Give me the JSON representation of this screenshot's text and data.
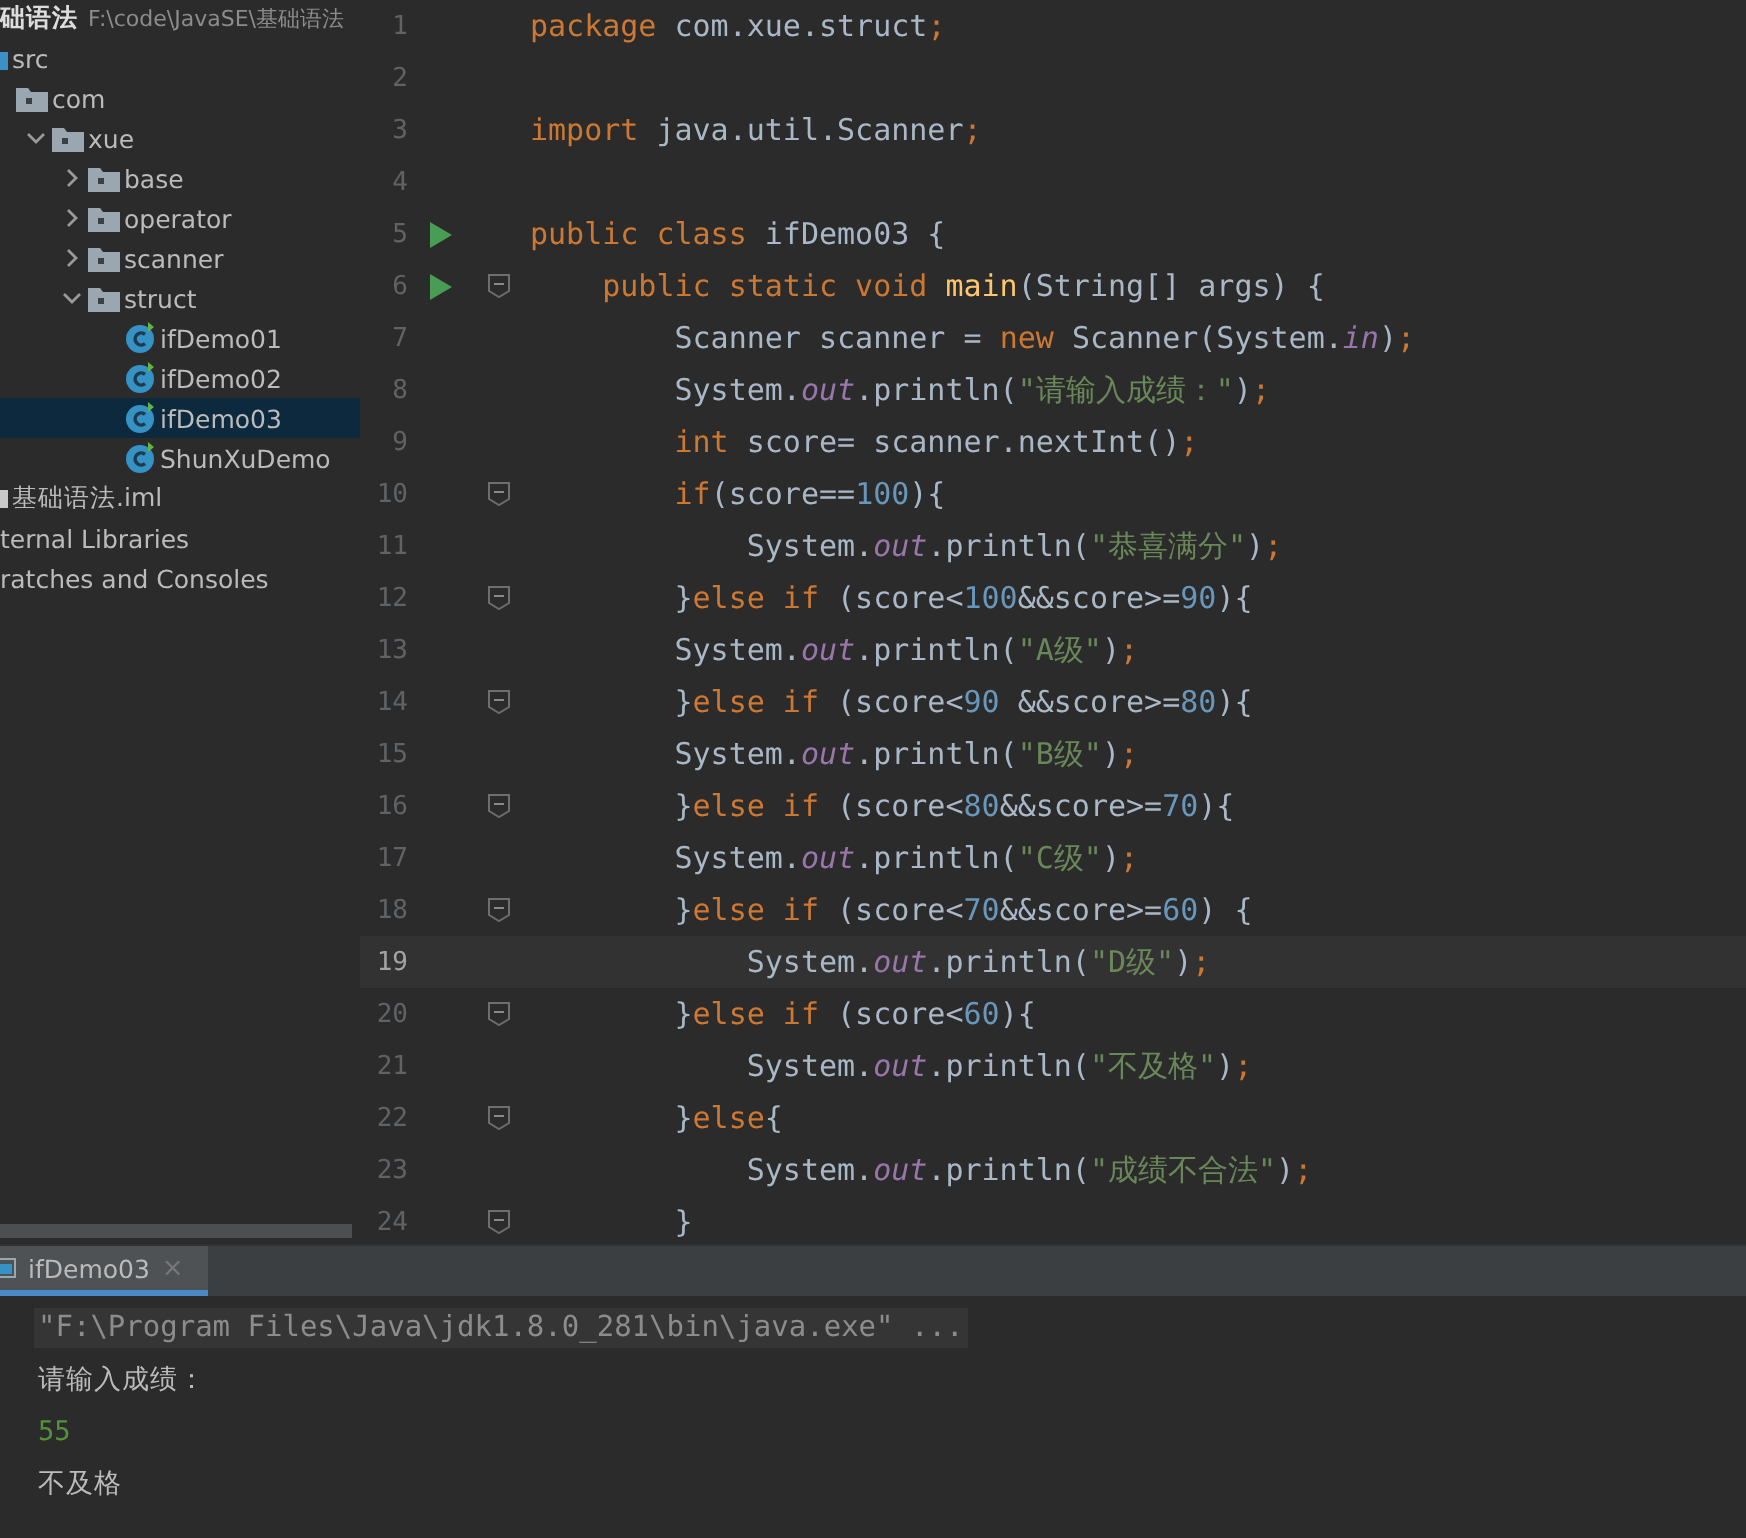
{
  "project_header": {
    "name": "础语法",
    "path": "F:\\code\\JavaSE\\基础语法"
  },
  "project_tree": [
    {
      "label": "src",
      "kind": "source",
      "selected": false,
      "children": [
        {
          "label": "com",
          "kind": "folder",
          "selected": false,
          "children": [
            {
              "label": "xue",
              "kind": "folder",
              "selected": false,
              "expanded": true,
              "children": [
                {
                  "label": "base",
                  "kind": "folder",
                  "selected": false,
                  "expanded": false
                },
                {
                  "label": "operator",
                  "kind": "folder",
                  "selected": false,
                  "expanded": false
                },
                {
                  "label": "scanner",
                  "kind": "folder",
                  "selected": false,
                  "expanded": false
                },
                {
                  "label": "struct",
                  "kind": "folder",
                  "selected": false,
                  "expanded": true,
                  "children": [
                    {
                      "label": "ifDemo01",
                      "kind": "class",
                      "selected": false
                    },
                    {
                      "label": "ifDemo02",
                      "kind": "class",
                      "selected": false
                    },
                    {
                      "label": "ifDemo03",
                      "kind": "class",
                      "selected": true
                    },
                    {
                      "label": "ShunXuDemo",
                      "kind": "class",
                      "selected": false
                    }
                  ]
                }
              ]
            }
          ]
        }
      ]
    },
    {
      "label": "基础语法.iml",
      "kind": "file",
      "selected": false
    },
    {
      "label": "ternal Libraries",
      "kind": "cut",
      "selected": false
    },
    {
      "label": "ratches and Consoles",
      "kind": "cut",
      "selected": false
    }
  ],
  "editor": {
    "lines": [
      {
        "number": "1",
        "tokens": [
          {
            "kind": "keyword",
            "text": "package "
          },
          {
            "kind": "plain",
            "text": "com.xue.struct"
          },
          {
            "kind": "keyword",
            "text": ";"
          }
        ]
      },
      {
        "number": "2"
      },
      {
        "number": "3",
        "tokens": [
          {
            "kind": "keyword",
            "text": "import "
          },
          {
            "kind": "plain",
            "text": "java.util.Scanner"
          },
          {
            "kind": "keyword",
            "text": ";"
          }
        ]
      },
      {
        "number": "4"
      },
      {
        "number": "5",
        "run": true,
        "tokens": [
          {
            "kind": "keyword",
            "text": "public class "
          },
          {
            "kind": "plain",
            "text": "ifDemo03 {"
          }
        ]
      },
      {
        "number": "6",
        "run": true,
        "fold": true,
        "tokens": [
          {
            "kind": "keyword",
            "text": "    public static void "
          },
          {
            "kind": "method",
            "text": "main"
          },
          {
            "kind": "plain",
            "text": "(String[] args) {"
          }
        ]
      },
      {
        "number": "7",
        "tokens": [
          {
            "kind": "plain",
            "text": "        Scanner scanner = "
          },
          {
            "kind": "keyword",
            "text": "new "
          },
          {
            "kind": "plain",
            "text": "Scanner(System."
          },
          {
            "kind": "field",
            "text": "in"
          },
          {
            "kind": "plain",
            "text": ")"
          },
          {
            "kind": "keyword",
            "text": ";"
          }
        ]
      },
      {
        "number": "8",
        "tokens": [
          {
            "kind": "plain",
            "text": "        System."
          },
          {
            "kind": "field",
            "text": "out"
          },
          {
            "kind": "plain",
            "text": ".println("
          },
          {
            "kind": "string",
            "text": "\"请输入成绩：\""
          },
          {
            "kind": "plain",
            "text": ")"
          },
          {
            "kind": "keyword",
            "text": ";"
          }
        ]
      },
      {
        "number": "9",
        "tokens": [
          {
            "kind": "keyword",
            "text": "        int "
          },
          {
            "kind": "plain",
            "text": "score= scanner.nextInt()"
          },
          {
            "kind": "keyword",
            "text": ";"
          }
        ]
      },
      {
        "number": "10",
        "fold": true,
        "tokens": [
          {
            "kind": "keyword",
            "text": "        if"
          },
          {
            "kind": "plain",
            "text": "(score=="
          },
          {
            "kind": "number",
            "text": "100"
          },
          {
            "kind": "plain",
            "text": "){"
          }
        ]
      },
      {
        "number": "11",
        "tokens": [
          {
            "kind": "plain",
            "text": "            System."
          },
          {
            "kind": "field",
            "text": "out"
          },
          {
            "kind": "plain",
            "text": ".println("
          },
          {
            "kind": "string",
            "text": "\"恭喜满分\""
          },
          {
            "kind": "plain",
            "text": ")"
          },
          {
            "kind": "keyword",
            "text": ";"
          }
        ]
      },
      {
        "number": "12",
        "fold": true,
        "tokens": [
          {
            "kind": "plain",
            "text": "        }"
          },
          {
            "kind": "keyword",
            "text": "else if "
          },
          {
            "kind": "plain",
            "text": "(score<"
          },
          {
            "kind": "number",
            "text": "100"
          },
          {
            "kind": "plain",
            "text": "&&score>="
          },
          {
            "kind": "number",
            "text": "90"
          },
          {
            "kind": "plain",
            "text": "){"
          }
        ]
      },
      {
        "number": "13",
        "tokens": [
          {
            "kind": "plain",
            "text": "        System."
          },
          {
            "kind": "field",
            "text": "out"
          },
          {
            "kind": "plain",
            "text": ".println("
          },
          {
            "kind": "string",
            "text": "\"A级\""
          },
          {
            "kind": "plain",
            "text": ")"
          },
          {
            "kind": "keyword",
            "text": ";"
          }
        ]
      },
      {
        "number": "14",
        "fold": true,
        "tokens": [
          {
            "kind": "plain",
            "text": "        }"
          },
          {
            "kind": "keyword",
            "text": "else if "
          },
          {
            "kind": "plain",
            "text": "(score<"
          },
          {
            "kind": "number",
            "text": "90"
          },
          {
            "kind": "plain",
            "text": " &&score>="
          },
          {
            "kind": "number",
            "text": "80"
          },
          {
            "kind": "plain",
            "text": "){"
          }
        ]
      },
      {
        "number": "15",
        "tokens": [
          {
            "kind": "plain",
            "text": "        System."
          },
          {
            "kind": "field",
            "text": "out"
          },
          {
            "kind": "plain",
            "text": ".println("
          },
          {
            "kind": "string",
            "text": "\"B级\""
          },
          {
            "kind": "plain",
            "text": ")"
          },
          {
            "kind": "keyword",
            "text": ";"
          }
        ]
      },
      {
        "number": "16",
        "fold": true,
        "tokens": [
          {
            "kind": "plain",
            "text": "        }"
          },
          {
            "kind": "keyword",
            "text": "else if "
          },
          {
            "kind": "plain",
            "text": "(score<"
          },
          {
            "kind": "number",
            "text": "80"
          },
          {
            "kind": "plain",
            "text": "&&score>="
          },
          {
            "kind": "number",
            "text": "70"
          },
          {
            "kind": "plain",
            "text": "){"
          }
        ]
      },
      {
        "number": "17",
        "tokens": [
          {
            "kind": "plain",
            "text": "        System."
          },
          {
            "kind": "field",
            "text": "out"
          },
          {
            "kind": "plain",
            "text": ".println("
          },
          {
            "kind": "string",
            "text": "\"C级\""
          },
          {
            "kind": "plain",
            "text": ")"
          },
          {
            "kind": "keyword",
            "text": ";"
          }
        ]
      },
      {
        "number": "18",
        "fold": true,
        "tokens": [
          {
            "kind": "plain",
            "text": "        }"
          },
          {
            "kind": "keyword",
            "text": "else if "
          },
          {
            "kind": "plain",
            "text": "(score<"
          },
          {
            "kind": "number",
            "text": "70"
          },
          {
            "kind": "plain",
            "text": "&&score>="
          },
          {
            "kind": "number",
            "text": "60"
          },
          {
            "kind": "plain",
            "text": ") {"
          }
        ]
      },
      {
        "number": "19",
        "current": true,
        "tokens": [
          {
            "kind": "plain",
            "text": "            System."
          },
          {
            "kind": "field",
            "text": "out"
          },
          {
            "kind": "plain",
            "text": ".println("
          },
          {
            "kind": "string",
            "text": "\"D级\""
          },
          {
            "kind": "plain",
            "text": ")"
          },
          {
            "kind": "keyword",
            "text": ";"
          }
        ]
      },
      {
        "number": "20",
        "fold": true,
        "tokens": [
          {
            "kind": "plain",
            "text": "        }"
          },
          {
            "kind": "keyword",
            "text": "else if "
          },
          {
            "kind": "plain",
            "text": "(score<"
          },
          {
            "kind": "number",
            "text": "60"
          },
          {
            "kind": "plain",
            "text": "){"
          }
        ]
      },
      {
        "number": "21",
        "tokens": [
          {
            "kind": "plain",
            "text": "            System."
          },
          {
            "kind": "field",
            "text": "out"
          },
          {
            "kind": "plain",
            "text": ".println("
          },
          {
            "kind": "string",
            "text": "\"不及格\""
          },
          {
            "kind": "plain",
            "text": ")"
          },
          {
            "kind": "keyword",
            "text": ";"
          }
        ]
      },
      {
        "number": "22",
        "fold": true,
        "tokens": [
          {
            "kind": "plain",
            "text": "        }"
          },
          {
            "kind": "keyword",
            "text": "else"
          },
          {
            "kind": "plain",
            "text": "{"
          }
        ]
      },
      {
        "number": "23",
        "tokens": [
          {
            "kind": "plain",
            "text": "            System."
          },
          {
            "kind": "field",
            "text": "out"
          },
          {
            "kind": "plain",
            "text": ".println("
          },
          {
            "kind": "string",
            "text": "\"成绩不合法\""
          },
          {
            "kind": "plain",
            "text": ")"
          },
          {
            "kind": "keyword",
            "text": ";"
          }
        ]
      },
      {
        "number": "24",
        "fold": true,
        "tokens": [
          {
            "kind": "plain",
            "text": "        }"
          }
        ]
      }
    ]
  },
  "run_panel": {
    "tabs": [
      {
        "label": "ifDemo03",
        "selected": true,
        "close": "×"
      }
    ],
    "output": [
      {
        "kind": "command",
        "text": "\"F:\\Program Files\\Java\\jdk1.8.0_281\\bin\\java.exe\" ..."
      },
      {
        "kind": "output",
        "text": "请输入成绩："
      },
      {
        "kind": "input",
        "text": "55"
      },
      {
        "kind": "output",
        "text": "不及格"
      }
    ]
  }
}
